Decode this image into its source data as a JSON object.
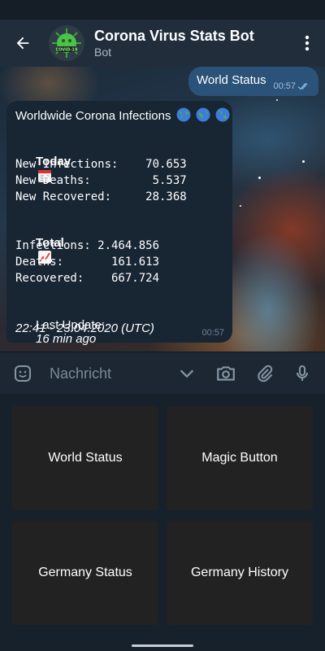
{
  "header": {
    "title": "Corona Virus Stats Bot",
    "subtitle": "Bot",
    "avatar_text": "COVID-19"
  },
  "outgoing_message": {
    "text": "World Status",
    "time": "00:57"
  },
  "incoming_message": {
    "title": "Worldwide Corona Infections",
    "today_label": "Today",
    "today_lines": [
      "New Infections:    70.653",
      "New Deaths:         5.537",
      "New Recovered:     28.368"
    ],
    "total_label": "Total",
    "total_lines": [
      "Infections: 2.464.856",
      "Deaths:       161.613",
      "Recovered:    667.724"
    ],
    "last_update_label": "Last Update:",
    "last_update_ago": "16 min ago",
    "last_update_time": "22:41 - 23.04.2020 (UTC)",
    "time": "00:57"
  },
  "input": {
    "placeholder": "Nachricht"
  },
  "keyboard": {
    "buttons": [
      "World Status",
      "Magic Button",
      "Germany Status",
      "Germany History"
    ]
  },
  "colors": {
    "header_bg": "#212d3b",
    "outgoing_bubble": "#2b5278",
    "incoming_bubble": "#182533",
    "keyboard_button": "#222222"
  }
}
